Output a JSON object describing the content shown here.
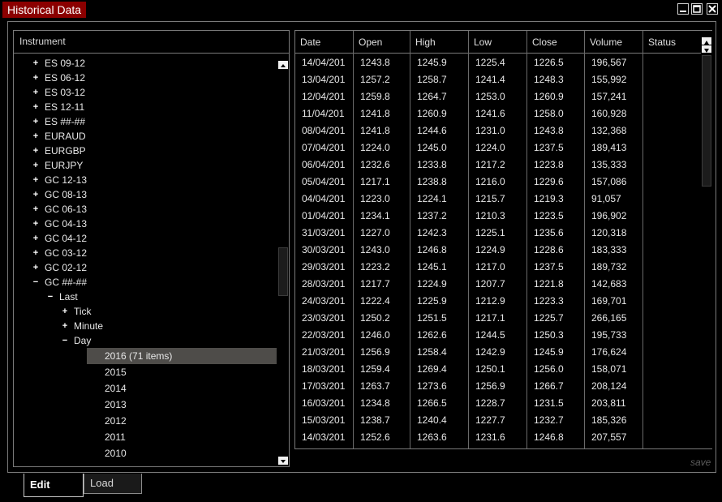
{
  "window": {
    "title": "Historical Data",
    "controls": {
      "minimize_icon": "minimize-icon",
      "maximize_icon": "maximize-icon",
      "close_icon": "close-icon"
    }
  },
  "tree": {
    "header": "Instrument",
    "items": [
      {
        "glyph": "+",
        "label": "ES 09-12",
        "level": 0
      },
      {
        "glyph": "+",
        "label": "ES 06-12",
        "level": 0
      },
      {
        "glyph": "+",
        "label": "ES 03-12",
        "level": 0
      },
      {
        "glyph": "+",
        "label": "ES 12-11",
        "level": 0
      },
      {
        "glyph": "+",
        "label": "ES ##-##",
        "level": 0
      },
      {
        "glyph": "+",
        "label": "EURAUD",
        "level": 0
      },
      {
        "glyph": "+",
        "label": "EURGBP",
        "level": 0
      },
      {
        "glyph": "+",
        "label": "EURJPY",
        "level": 0
      },
      {
        "glyph": "+",
        "label": "GC 12-13",
        "level": 0
      },
      {
        "glyph": "+",
        "label": "GC 08-13",
        "level": 0
      },
      {
        "glyph": "+",
        "label": "GC 06-13",
        "level": 0
      },
      {
        "glyph": "+",
        "label": "GC 04-13",
        "level": 0
      },
      {
        "glyph": "+",
        "label": "GC 04-12",
        "level": 0
      },
      {
        "glyph": "+",
        "label": "GC 03-12",
        "level": 0
      },
      {
        "glyph": "+",
        "label": "GC 02-12",
        "level": 0
      },
      {
        "glyph": "−",
        "label": "GC ##-##",
        "level": 0
      },
      {
        "glyph": "−",
        "label": "Last",
        "level": 1
      },
      {
        "glyph": "+",
        "label": "Tick",
        "level": 2
      },
      {
        "glyph": "+",
        "label": "Minute",
        "level": 2
      },
      {
        "glyph": "−",
        "label": "Day",
        "level": 2
      }
    ],
    "years": [
      {
        "label": "2016 (71 items)",
        "selected": true
      },
      {
        "label": "2015",
        "selected": false
      },
      {
        "label": "2014",
        "selected": false
      },
      {
        "label": "2013",
        "selected": false
      },
      {
        "label": "2012",
        "selected": false
      },
      {
        "label": "2011",
        "selected": false
      },
      {
        "label": "2010",
        "selected": false
      }
    ]
  },
  "grid": {
    "columns": [
      "Date",
      "Open",
      "High",
      "Low",
      "Close",
      "Volume",
      "Status"
    ],
    "rows": [
      [
        "14/04/201",
        "1243.8",
        "1245.9",
        "1225.4",
        "1226.5",
        "196,567",
        ""
      ],
      [
        "13/04/201",
        "1257.2",
        "1258.7",
        "1241.4",
        "1248.3",
        "155,992",
        ""
      ],
      [
        "12/04/201",
        "1259.8",
        "1264.7",
        "1253.0",
        "1260.9",
        "157,241",
        ""
      ],
      [
        "11/04/201",
        "1241.8",
        "1260.9",
        "1241.6",
        "1258.0",
        "160,928",
        ""
      ],
      [
        "08/04/201",
        "1241.8",
        "1244.6",
        "1231.0",
        "1243.8",
        "132,368",
        ""
      ],
      [
        "07/04/201",
        "1224.0",
        "1245.0",
        "1224.0",
        "1237.5",
        "189,413",
        ""
      ],
      [
        "06/04/201",
        "1232.6",
        "1233.8",
        "1217.2",
        "1223.8",
        "135,333",
        ""
      ],
      [
        "05/04/201",
        "1217.1",
        "1238.8",
        "1216.0",
        "1229.6",
        "157,086",
        ""
      ],
      [
        "04/04/201",
        "1223.0",
        "1224.1",
        "1215.7",
        "1219.3",
        "91,057",
        ""
      ],
      [
        "01/04/201",
        "1234.1",
        "1237.2",
        "1210.3",
        "1223.5",
        "196,902",
        ""
      ],
      [
        "31/03/201",
        "1227.0",
        "1242.3",
        "1225.1",
        "1235.6",
        "120,318",
        ""
      ],
      [
        "30/03/201",
        "1243.0",
        "1246.8",
        "1224.9",
        "1228.6",
        "183,333",
        ""
      ],
      [
        "29/03/201",
        "1223.2",
        "1245.1",
        "1217.0",
        "1237.5",
        "189,732",
        ""
      ],
      [
        "28/03/201",
        "1217.7",
        "1224.9",
        "1207.7",
        "1221.8",
        "142,683",
        ""
      ],
      [
        "24/03/201",
        "1222.4",
        "1225.9",
        "1212.9",
        "1223.3",
        "169,701",
        ""
      ],
      [
        "23/03/201",
        "1250.2",
        "1251.5",
        "1217.1",
        "1225.7",
        "266,165",
        ""
      ],
      [
        "22/03/201",
        "1246.0",
        "1262.6",
        "1244.5",
        "1250.3",
        "195,733",
        ""
      ],
      [
        "21/03/201",
        "1256.9",
        "1258.4",
        "1242.9",
        "1245.9",
        "176,624",
        ""
      ],
      [
        "18/03/201",
        "1259.4",
        "1269.4",
        "1250.1",
        "1256.0",
        "158,071",
        ""
      ],
      [
        "17/03/201",
        "1263.7",
        "1273.6",
        "1256.9",
        "1266.7",
        "208,124",
        ""
      ],
      [
        "16/03/201",
        "1234.8",
        "1266.5",
        "1228.7",
        "1231.5",
        "203,811",
        ""
      ],
      [
        "15/03/201",
        "1238.7",
        "1240.4",
        "1227.7",
        "1232.7",
        "185,326",
        ""
      ],
      [
        "14/03/201",
        "1252.6",
        "1263.6",
        "1231.6",
        "1246.8",
        "207,557",
        ""
      ]
    ]
  },
  "footer": {
    "save_label": "save",
    "tabs": [
      {
        "label": "Edit",
        "active": true
      },
      {
        "label": "Load",
        "active": false
      }
    ]
  },
  "colors": {
    "title_bg": "#8b0000",
    "selected_row_bg": "#4e4c49",
    "border": "#7a7a7a",
    "save_text": "#5c5c5c"
  }
}
